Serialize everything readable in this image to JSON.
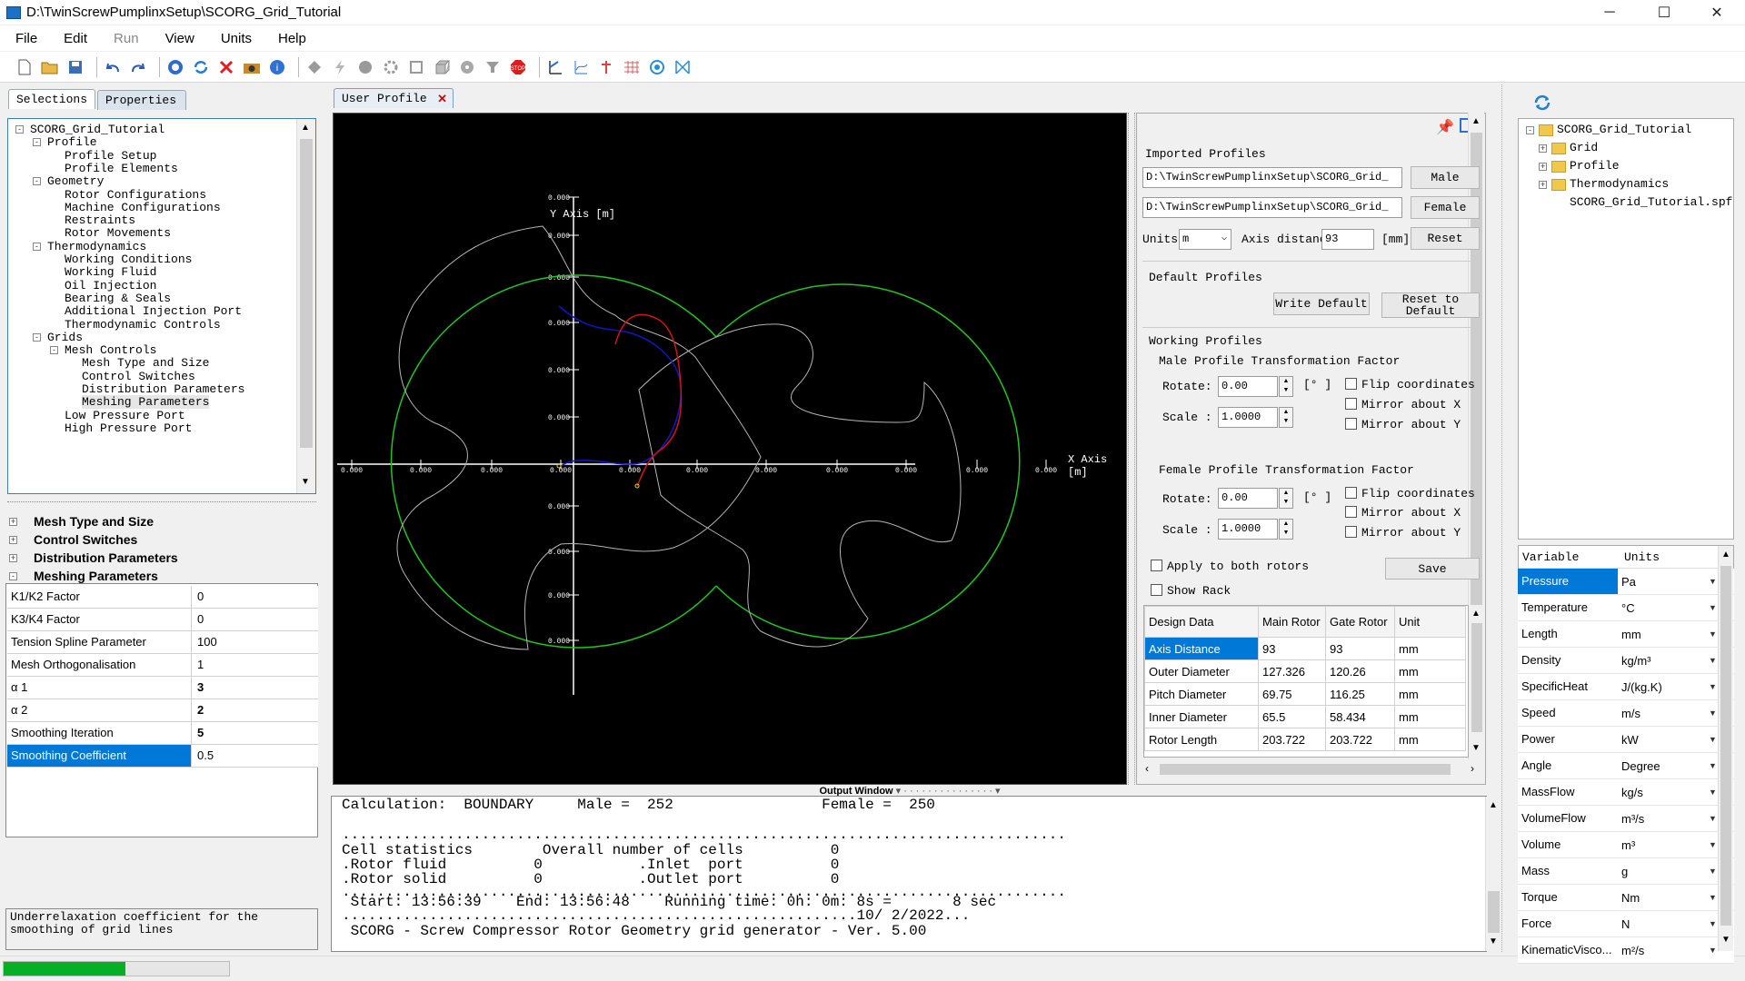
{
  "window": {
    "title": "D:\\TwinScrewPumplinxSetup\\SCORG_Grid_Tutorial",
    "minimize": "─",
    "maximize": "☐",
    "close": "✕"
  },
  "menu": [
    "File",
    "Edit",
    "Run",
    "View",
    "Units",
    "Help"
  ],
  "left_tabs": {
    "selections": "Selections",
    "properties": "Properties"
  },
  "tree": [
    {
      "label": "SCORG_Grid_Tutorial",
      "level": 0,
      "toggle": "-"
    },
    {
      "label": "Profile",
      "level": 1,
      "toggle": "-"
    },
    {
      "label": "Profile Setup",
      "level": 2
    },
    {
      "label": "Profile Elements",
      "level": 2
    },
    {
      "label": "Geometry",
      "level": 1,
      "toggle": "-"
    },
    {
      "label": "Rotor Configurations",
      "level": 2
    },
    {
      "label": "Machine Configurations",
      "level": 2
    },
    {
      "label": "Restraints",
      "level": 2
    },
    {
      "label": "Rotor Movements",
      "level": 2
    },
    {
      "label": "Thermodynamics",
      "level": 1,
      "toggle": "-"
    },
    {
      "label": "Working Conditions",
      "level": 2
    },
    {
      "label": "Working Fluid",
      "level": 2
    },
    {
      "label": "Oil Injection",
      "level": 2
    },
    {
      "label": "Bearing & Seals",
      "level": 2
    },
    {
      "label": "Additional Injection Port",
      "level": 2
    },
    {
      "label": "Thermodynamic Controls",
      "level": 2
    },
    {
      "label": "Grids",
      "level": 1,
      "toggle": "-"
    },
    {
      "label": "Mesh Controls",
      "level": 2,
      "toggle": "-"
    },
    {
      "label": "Mesh Type and Size",
      "level": 3
    },
    {
      "label": "Control Switches",
      "level": 3
    },
    {
      "label": "Distribution Parameters",
      "level": 3
    },
    {
      "label": "Meshing Parameters",
      "level": 3,
      "selected": true
    },
    {
      "label": "Low Pressure Port",
      "level": 2
    },
    {
      "label": "High Pressure Port",
      "level": 2
    }
  ],
  "sections": [
    {
      "label": "Mesh Type and Size",
      "toggle": "+"
    },
    {
      "label": "Control Switches",
      "toggle": "+"
    },
    {
      "label": "Distribution Parameters",
      "toggle": "+"
    },
    {
      "label": "Meshing Parameters",
      "toggle": "-"
    }
  ],
  "properties": [
    {
      "name": "K1/K2 Factor",
      "value": "0"
    },
    {
      "name": "K3/K4 Factor",
      "value": "0"
    },
    {
      "name": "Tension Spline Parameter",
      "value": "100"
    },
    {
      "name": "Mesh Orthogonalisation",
      "value": "1"
    },
    {
      "name": "α 1",
      "value": "3",
      "bold": true
    },
    {
      "name": "α 2",
      "value": "2",
      "bold": true
    },
    {
      "name": "Smoothing Iteration",
      "value": "5",
      "bold": true
    },
    {
      "name": "Smoothing Coefficient",
      "value": "0.5",
      "selected": true
    }
  ],
  "description": "Underrelaxation coefficient for the smoothing of grid lines",
  "progress": 0.54,
  "viewer": {
    "tab": "User Profile",
    "y_axis_label": "Y Axis [m]",
    "x_axis_label": "X Axis [m]",
    "y_ticks": [
      "0.000",
      "0.000",
      "0.000",
      "0.000",
      "0.000",
      "0.000",
      "0.000",
      "0.000",
      "0.000",
      "0.000"
    ],
    "x_ticks": [
      "0.000",
      "0.000",
      "0.000",
      "0.000",
      "0.000",
      "0.000",
      "0.000",
      "0.000",
      "0.000",
      "0.000",
      "0.000"
    ],
    "colors": {
      "circle": "#22c51e",
      "profile": "#b4b4b4",
      "male_rack": "#1414c8",
      "female_rack": "#d41414",
      "axis": "#ffffff"
    }
  },
  "profiles": {
    "imported_title": "Imported Profiles",
    "male_path": "D:\\TwinScrewPumplinxSetup\\SCORG_Grid_",
    "female_path": "D:\\TwinScrewPumplinxSetup\\SCORG_Grid_",
    "male_btn": "Male",
    "female_btn": "Female",
    "units_label": "Units",
    "units_value": "m",
    "axis_label": "Axis distanc",
    "axis_value": "93",
    "axis_unit": "[mm]",
    "reset_btn": "Reset",
    "default_title": "Default Profiles",
    "write_default_btn": "Write Default",
    "reset_default_btn": "Reset to Default",
    "working_title": "Working Profiles",
    "male_tf_title": "Male Profile Transformation Factor",
    "female_tf_title": "Female Profile Transformation Factor",
    "rotate_label": "Rotate:",
    "scale_label": "Scale :",
    "deg_unit": "[° ]",
    "male_rotate": "0.00",
    "male_scale": "1.0000",
    "female_rotate": "0.00",
    "female_scale": "1.0000",
    "flip": "Flip coordinates",
    "mirror_x": "Mirror about X",
    "mirror_y": "Mirror about Y",
    "apply_both": "Apply to both rotors",
    "show_rack": "Show Rack",
    "save_btn": "Save"
  },
  "design_table": {
    "headers": [
      "Design Data",
      "Main Rotor",
      "Gate Rotor",
      "Unit"
    ],
    "rows": [
      {
        "name": "Axis Distance",
        "main": "93",
        "gate": "93",
        "unit": "mm",
        "selected": true
      },
      {
        "name": "Outer Diameter",
        "main": "127.326",
        "gate": "120.26",
        "unit": "mm"
      },
      {
        "name": "Pitch Diameter",
        "main": "69.75",
        "gate": "116.25",
        "unit": "mm"
      },
      {
        "name": "Inner Diameter",
        "main": "65.5",
        "gate": "58.434",
        "unit": "mm"
      },
      {
        "name": "Rotor Length",
        "main": "203.722",
        "gate": "203.722",
        "unit": "mm"
      }
    ]
  },
  "output": {
    "title": "Output Window",
    "lines": [
      "Calculation:  BOUNDARY     Male =  252                 Female =  250",
      "...................................................................................",
      "Cell statistics        Overall number of cells          0",
      ".Rotor fluid          0           .Inlet  port          0",
      ".Rotor solid          0           .Outlet port          0",
      "...................................................................................",
      " Start: 13:56:39    End: 13:56:48    Running time: 0h: 0m: 8s =       8 sec",
      "...........................................................10/ 2/2022...",
      " SCORG - Screw Compressor Rotor Geometry grid generator - Ver. 5.00"
    ]
  },
  "right_tree": [
    {
      "label": "SCORG_Grid_Tutorial",
      "toggle": "-",
      "folder": true
    },
    {
      "label": "Grid",
      "toggle": "+",
      "folder": true
    },
    {
      "label": "Profile",
      "toggle": "+",
      "folder": true
    },
    {
      "label": "Thermodynamics",
      "toggle": "+",
      "folder": true
    },
    {
      "label": "SCORG_Grid_Tutorial.spf",
      "folder": false
    }
  ],
  "units_table": {
    "headers": [
      "Variable",
      "Units"
    ],
    "rows": [
      {
        "var": "Pressure",
        "unit": "Pa",
        "selected": true
      },
      {
        "var": "Temperature",
        "unit": "°C"
      },
      {
        "var": "Length",
        "unit": "mm"
      },
      {
        "var": "Density",
        "unit": "kg/m³"
      },
      {
        "var": "SpecificHeat",
        "unit": "J/(kg.K)"
      },
      {
        "var": "Speed",
        "unit": "m/s"
      },
      {
        "var": "Power",
        "unit": "kW"
      },
      {
        "var": "Angle",
        "unit": "Degree"
      },
      {
        "var": "MassFlow",
        "unit": "kg/s"
      },
      {
        "var": "VolumeFlow",
        "unit": "m³/s"
      },
      {
        "var": "Volume",
        "unit": "m³"
      },
      {
        "var": "Mass",
        "unit": "g"
      },
      {
        "var": "Torque",
        "unit": "Nm"
      },
      {
        "var": "Force",
        "unit": "N"
      },
      {
        "var": "KinematicVisco...",
        "unit": "m²/s"
      }
    ]
  }
}
